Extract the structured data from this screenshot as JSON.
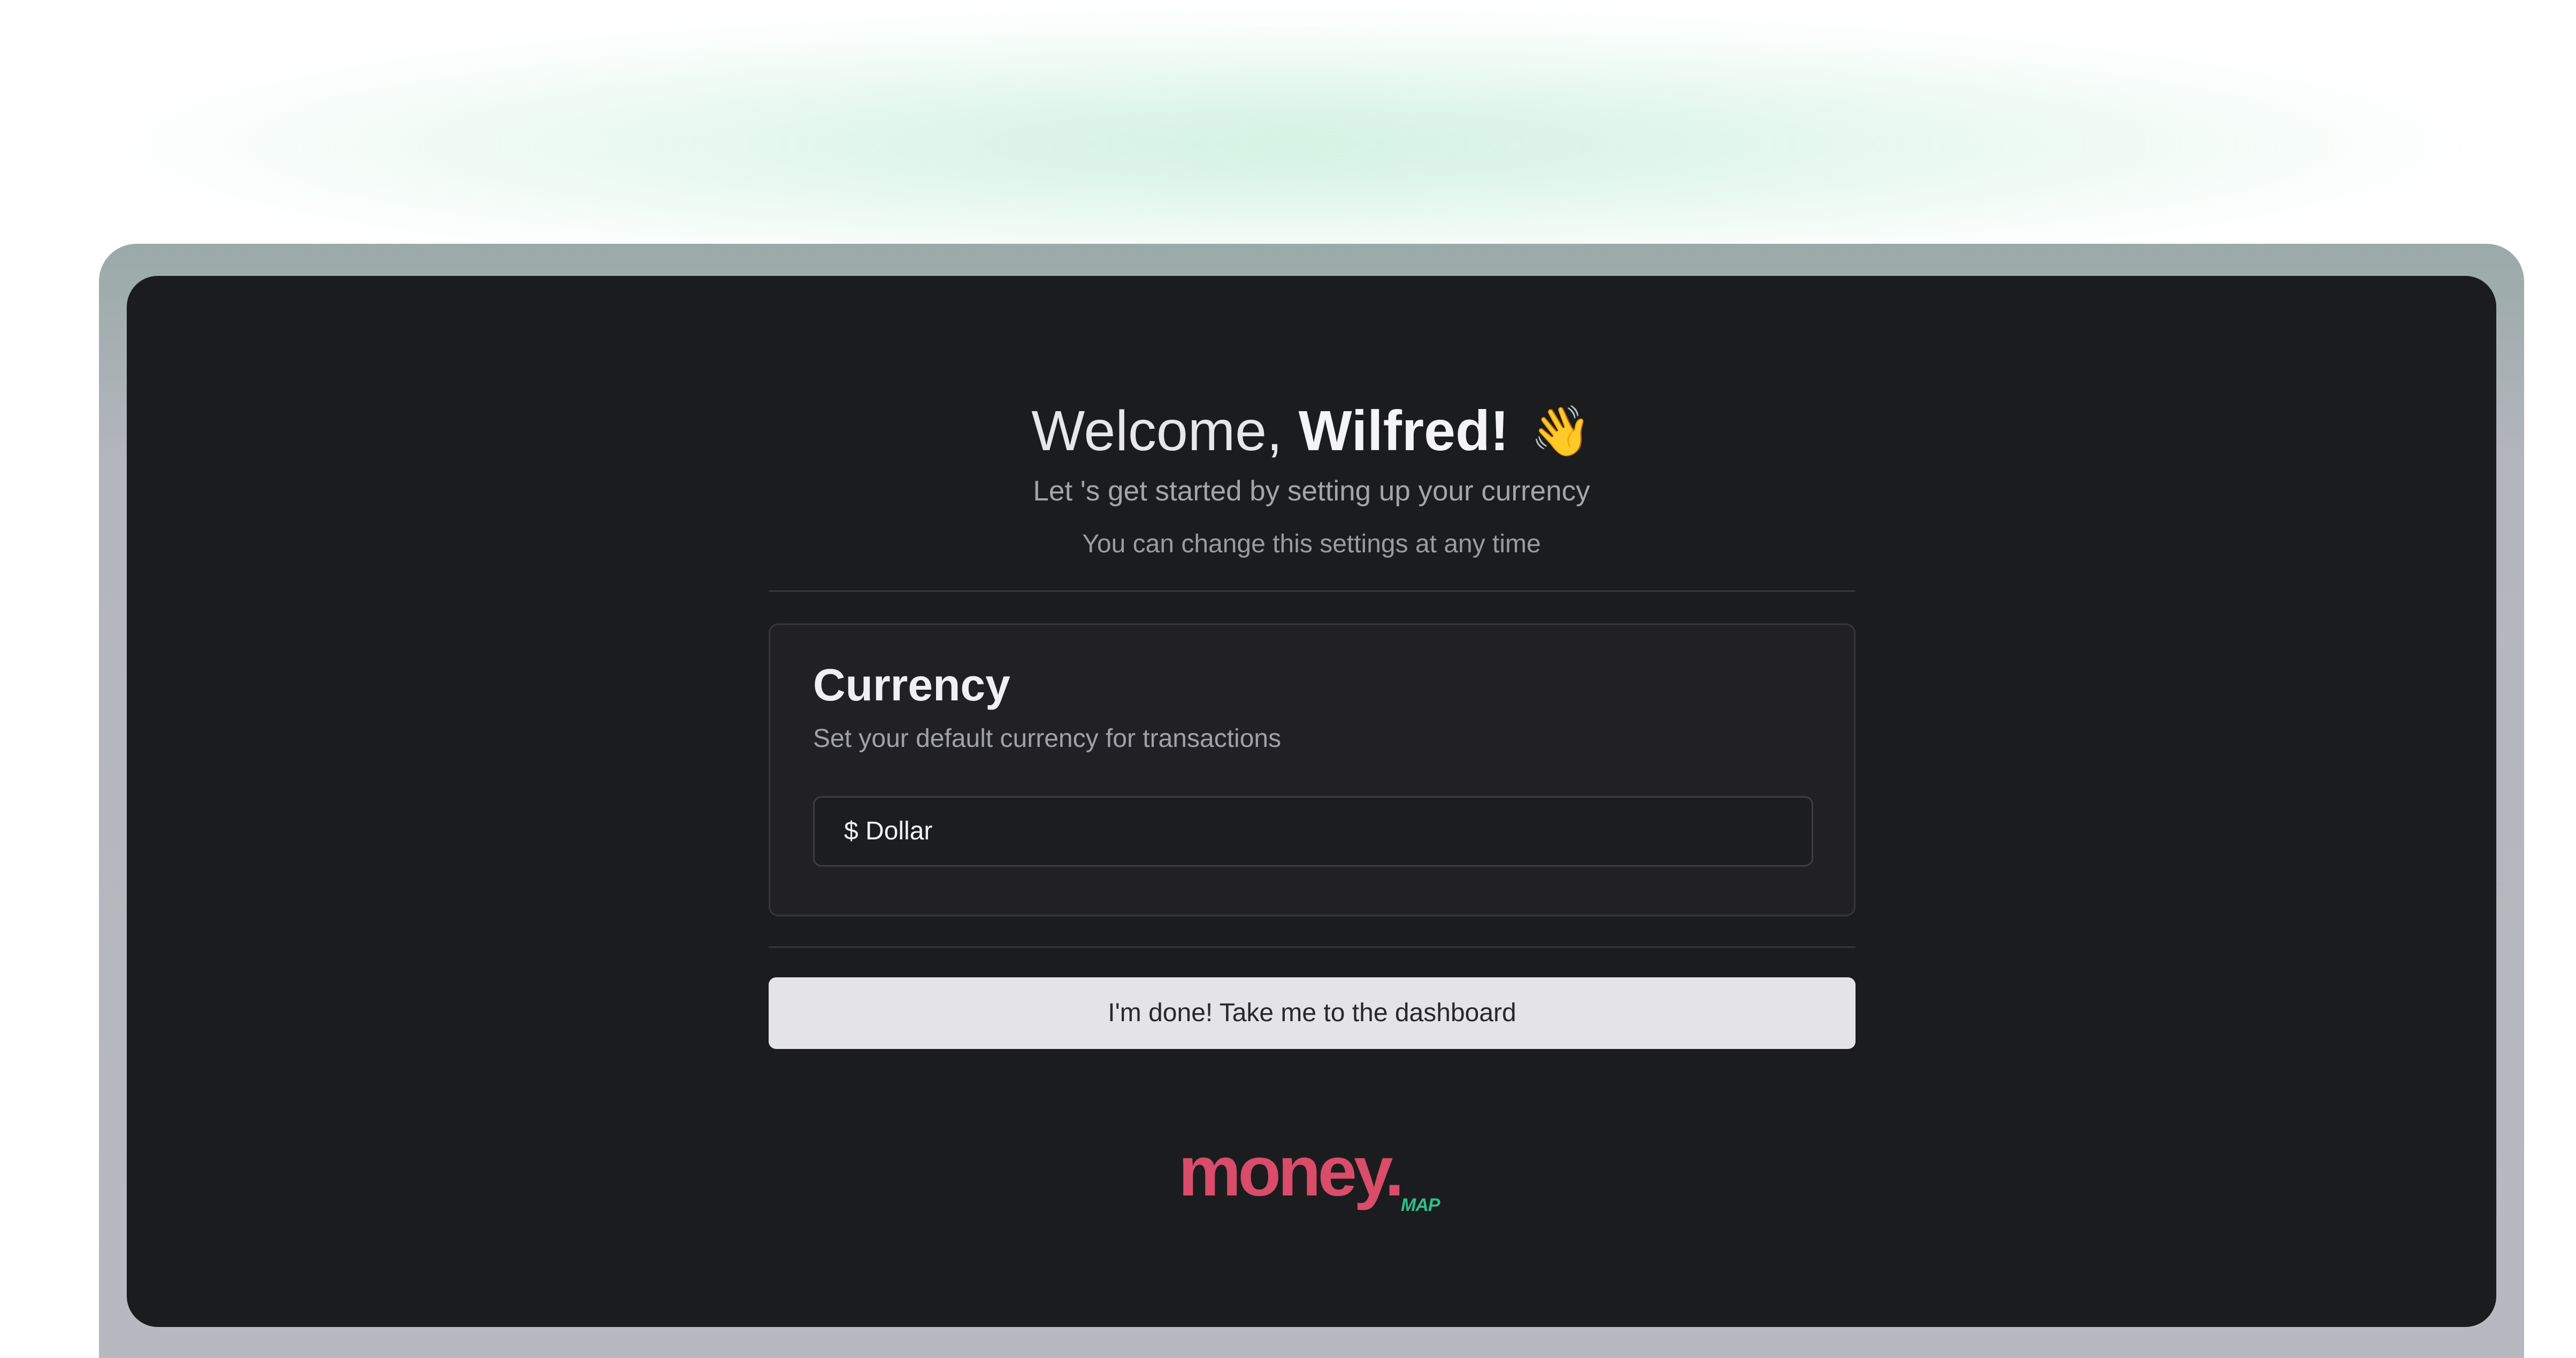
{
  "welcome": {
    "greeting": "Welcome,",
    "name": "Wilfred!",
    "emoji": "👋",
    "subtitle": "Let 's get started by setting up your currency",
    "note": "You can change this settings at any time"
  },
  "currency_card": {
    "title": "Currency",
    "description": "Set your default currency for transactions",
    "selected_value": "$ Dollar"
  },
  "actions": {
    "done_label": "I'm done! Take me to the dashboard"
  },
  "brand": {
    "logo_main": "money.",
    "logo_sub": "MAP",
    "primary_color": "#d94c6a",
    "secondary_color": "#2fbf8a"
  },
  "colors": {
    "screen_background": "#1b1c1e",
    "card_background": "#212125",
    "button_background": "#e4e4e7"
  }
}
